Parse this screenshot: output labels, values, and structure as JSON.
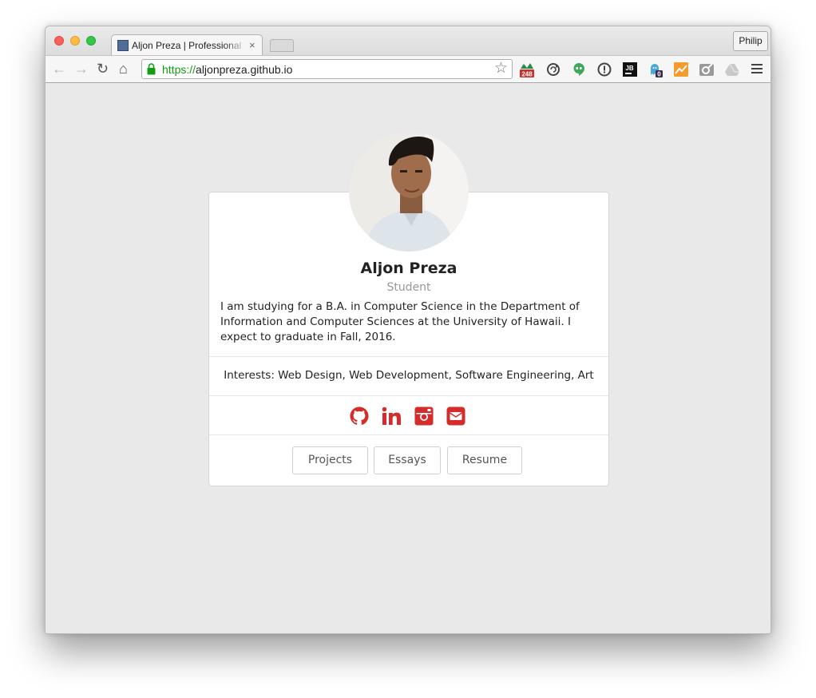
{
  "browser": {
    "tab_title": "Aljon Preza | Professional Portfolio",
    "tab_close": "×",
    "profile_name": "Philip",
    "url_scheme": "https://",
    "url_host": "aljonpreza.github.io",
    "bookmark_icon": "☆",
    "nav": {
      "back": "←",
      "forward": "→",
      "reload": "↻",
      "home": "⌂"
    },
    "extension_badges": {
      "first": "248",
      "ghost": "0"
    }
  },
  "profile": {
    "name": "Aljon Preza",
    "role": "Student",
    "bio": "I am studying for a B.A. in Computer Science in the Department of Information and Computer Sciences at the University of Hawaii. I expect to graduate in Fall, 2016.",
    "interests": "Interests: Web Design, Web Development, Software Engineering, Art"
  },
  "social": [
    "github-icon",
    "linkedin-icon",
    "instagram-icon",
    "email-icon"
  ],
  "buttons": {
    "projects": "Projects",
    "essays": "Essays",
    "resume": "Resume"
  },
  "colors": {
    "accent": "#d52b2b",
    "url_green": "#129d12"
  }
}
